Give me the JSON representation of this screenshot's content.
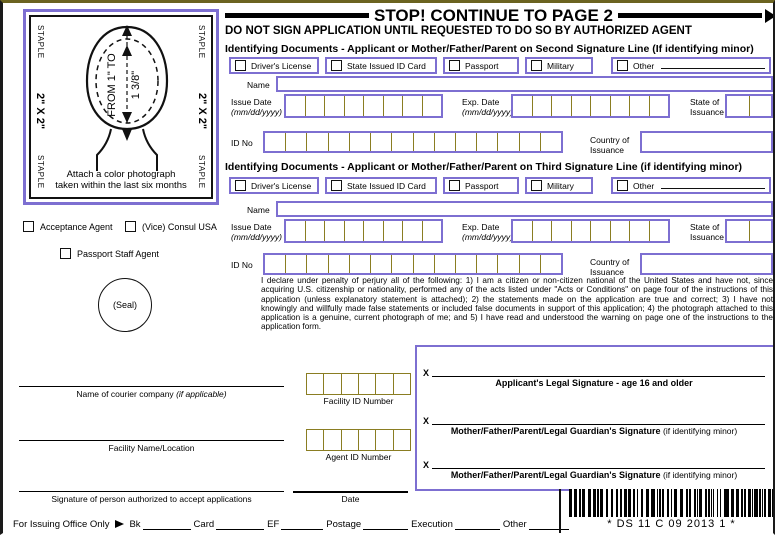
{
  "header": {
    "stop_title": "STOP! CONTINUE TO PAGE 2",
    "no_sign": "DO NOT SIGN APPLICATION UNTIL REQUESTED TO DO SO BY AUTHORIZED AGENT"
  },
  "photo": {
    "staple_top_left": "STAPLE",
    "staple_top_right": "STAPLE",
    "staple_bottom_left": "STAPLE",
    "staple_bottom_right": "STAPLE",
    "size_left": "2\" X 2\"",
    "size_right": "2\" X 2\"",
    "measure_from": "FROM 1\" TO",
    "measure_to": "1 3/8\"",
    "caption_line1": "Attach a color photograph",
    "caption_line2": "taken within the last six months"
  },
  "agent": {
    "acceptance_agent": "Acceptance Agent",
    "vice_consul": "(Vice) Consul USA",
    "passport_staff": "Passport Staff Agent",
    "seal": "(Seal)"
  },
  "section2": {
    "heading": "Identifying Documents - Applicant or Mother/Father/Parent on Second Signature Line (If identifying minor)",
    "checks": [
      "Driver's License",
      "State Issued ID Card",
      "Passport",
      "Military",
      "Other"
    ],
    "name_label": "Name",
    "issue_date_l1": "Issue Date",
    "issue_date_l2": "(mm/dd/yyyy)",
    "exp_date_l1": "Exp. Date",
    "exp_date_l2": "(mm/dd/yyyy)",
    "state_l1": "State of",
    "state_l2": "Issuance",
    "id_no_label": "ID No",
    "country_l1": "Country of",
    "country_l2": "Issuance"
  },
  "section3": {
    "heading": "Identifying Documents - Applicant or Mother/Father/Parent on Third Signature Line (if identifying minor)",
    "checks": [
      "Driver's License",
      "State Issued ID Card",
      "Passport",
      "Military",
      "Other"
    ],
    "name_label": "Name",
    "issue_date_l1": "Issue Date",
    "issue_date_l2": "(mm/dd/yyyy)",
    "exp_date_l1": "Exp. Date",
    "exp_date_l2": "(mm/dd/yyyy)",
    "state_l1": "State of",
    "state_l2": "Issuance",
    "id_no_label": "ID No",
    "country_l1": "Country of",
    "country_l2": "Issuance"
  },
  "declaration": "I declare under penalty of perjury all of the following: 1) I am a citizen or non-citizen national of the United States and have not, since acquiring U.S. citizenship or nationality, performed any of the acts listed under \"Acts or Conditions\" on page four of the instructions of this application (unless explanatory statement is attached); 2) the statements made on the application are true and correct; 3) I have not knowingly and willfully made false statements or included false documents in support of this application; 4) the photograph attached to this application is a genuine, current photograph of me; and 5) I have read and understood the warning on page one of the instructions to the application form.",
  "signatures": {
    "x_mark": "X",
    "line1_caption": "Applicant's Legal Signature - age 16 and older",
    "line1_note": "",
    "line2_caption": "Mother/Father/Parent/Legal Guardian's Signature",
    "line2_note": "(if identifying minor)",
    "line3_caption": "Mother/Father/Parent/Legal Guardian's Signature",
    "line3_note": "(if identifying minor)"
  },
  "bottom_left": {
    "courier_label": "Name of courier company",
    "courier_note": "(if applicable)",
    "facility_id_label": "Facility ID Number",
    "facility_name_label": "Facility Name/Location",
    "agent_id_label": "Agent ID Number",
    "auth_sig_label": "Signature of person authorized to accept applications",
    "date_label": "Date"
  },
  "footer": {
    "issuing_office": "For Issuing Office Only",
    "items": [
      "Bk",
      "Card",
      "EF",
      "Postage",
      "Execution",
      "Other"
    ]
  },
  "barcode": {
    "text": "* DS 11 C 09 2013 1 *"
  },
  "colors": {
    "field_violet": "#7d6fd1",
    "comb_olive": "#8a7d22",
    "border_dark": "#1a1a1a"
  }
}
